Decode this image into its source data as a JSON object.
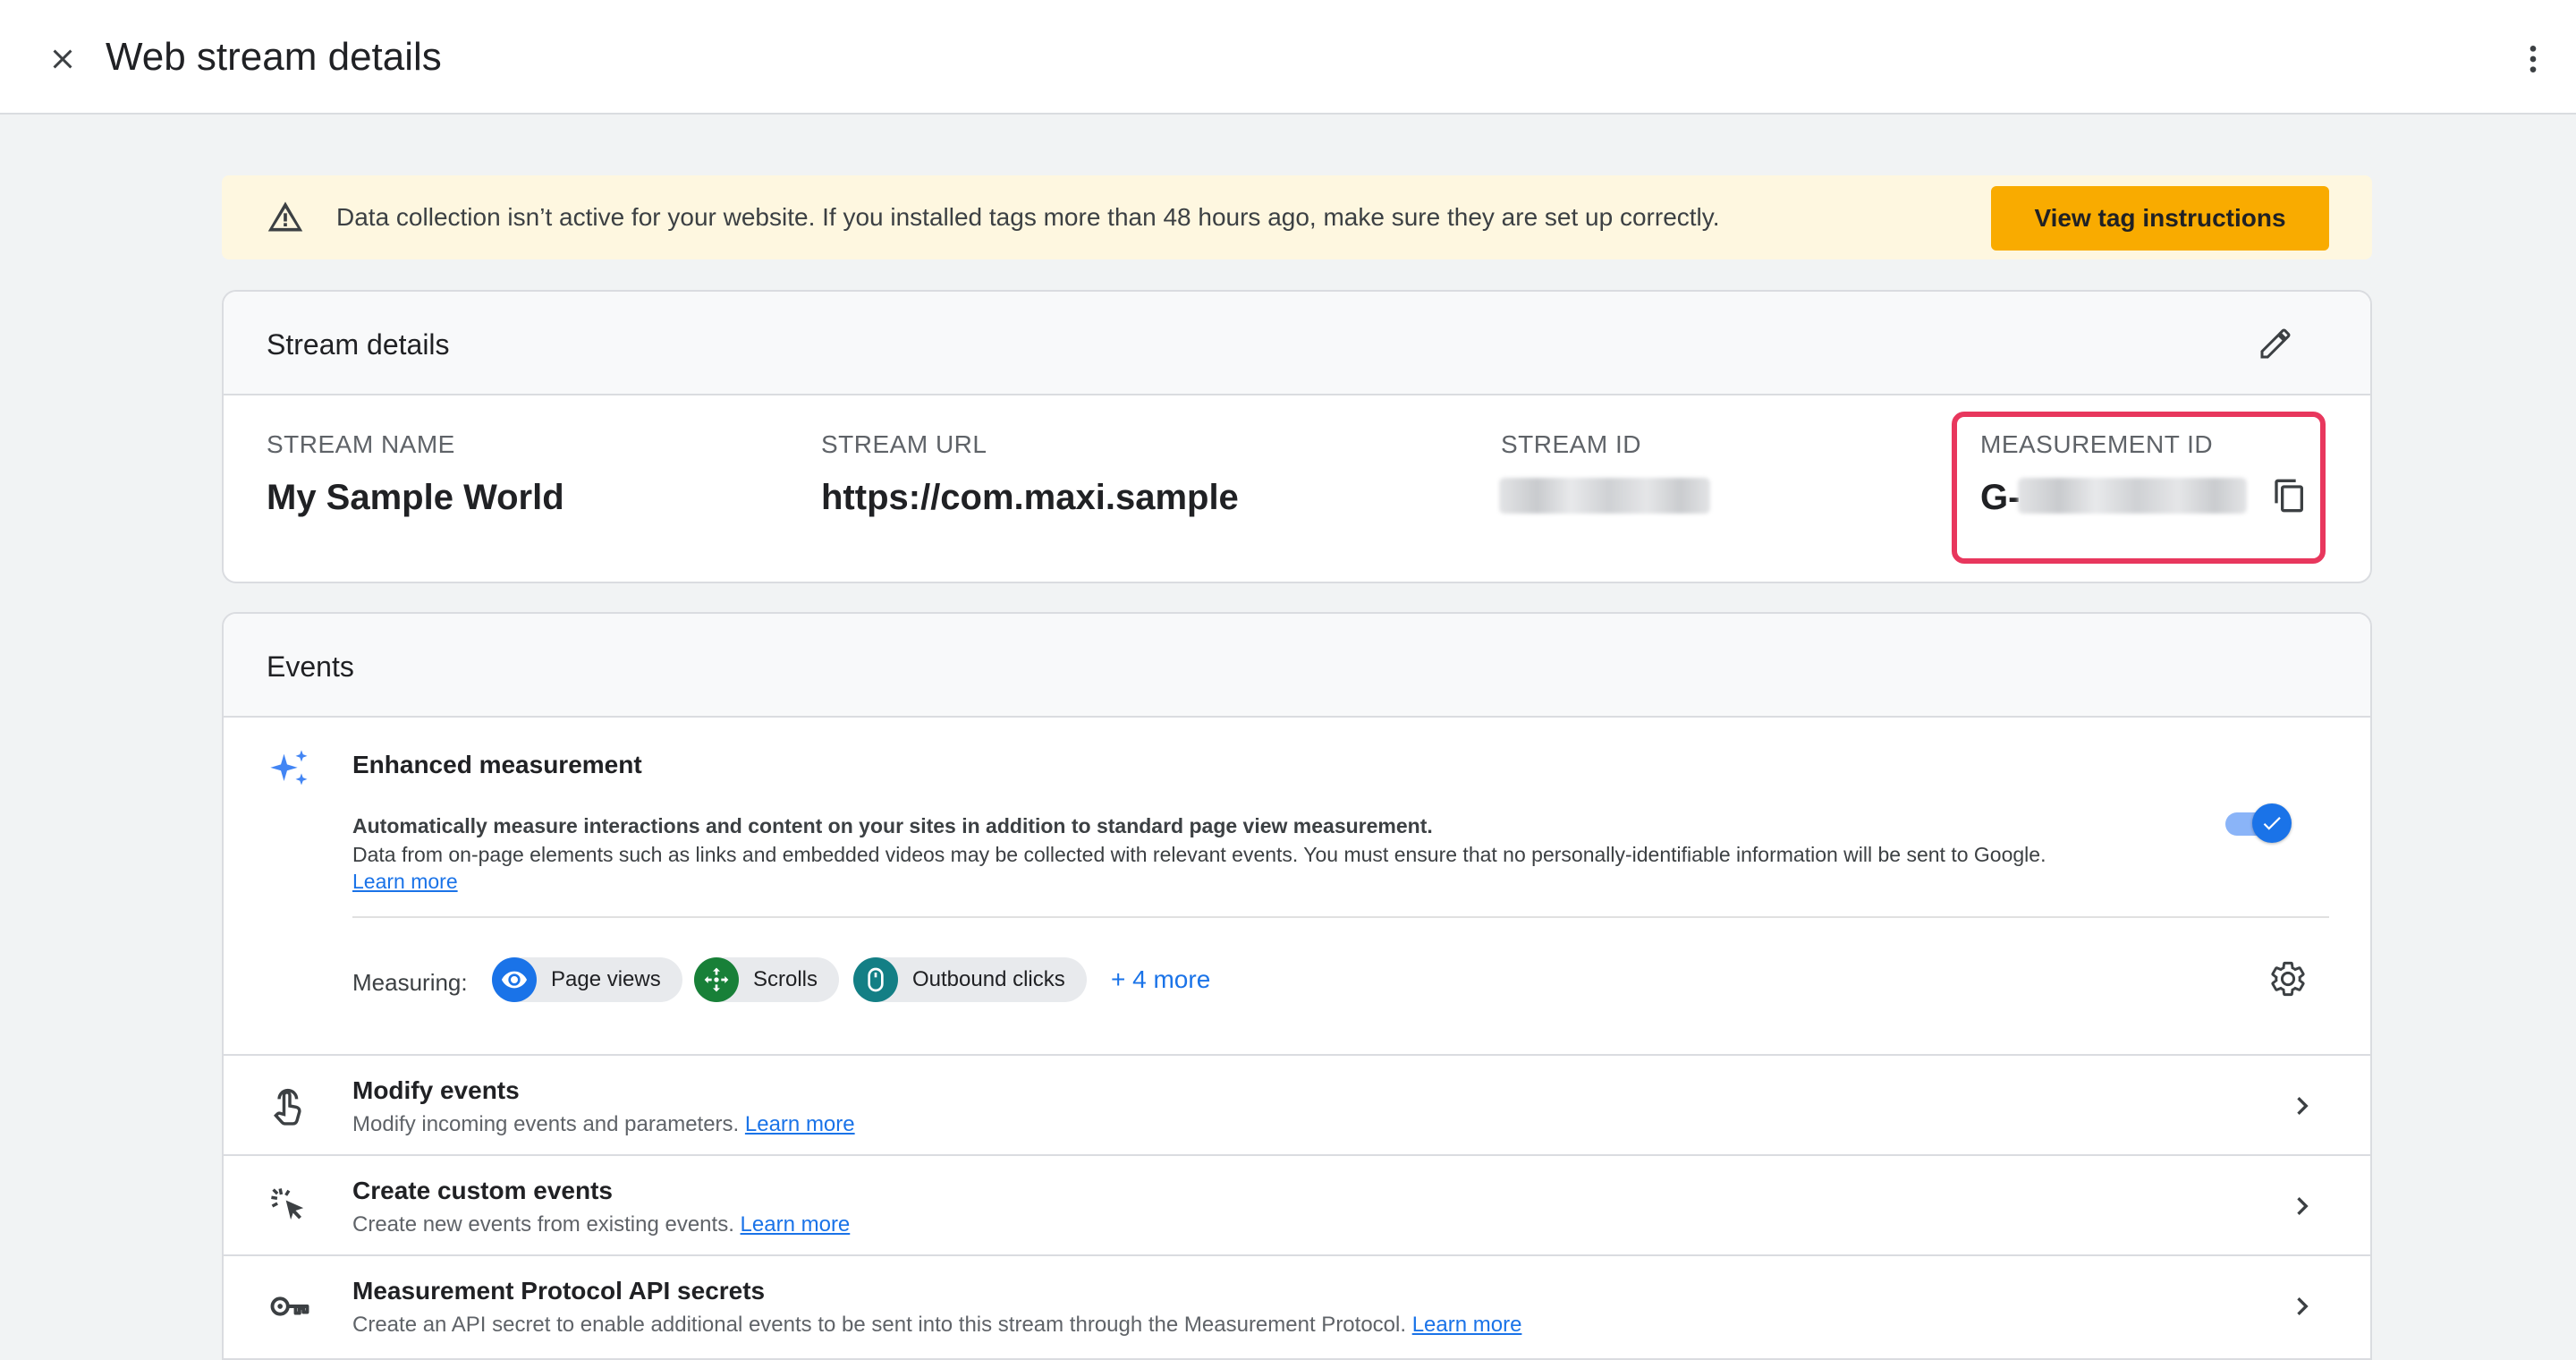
{
  "header": {
    "title": "Web stream details",
    "close_icon": "close-icon",
    "more_icon": "more-vert-icon"
  },
  "banner": {
    "message": "Data collection isn’t active for your website. If you installed tags more than 48 hours ago, make sure they are set up correctly.",
    "button_label": "View tag instructions",
    "icon": "warning-icon",
    "color_bg": "#fef7e0",
    "color_button": "#f9ab00"
  },
  "stream_details": {
    "title": "Stream details",
    "edit_icon": "edit-icon",
    "fields": [
      {
        "label": "STREAM NAME",
        "value": "My Sample World"
      },
      {
        "label": "STREAM URL",
        "value": "https://com.maxi.sample"
      },
      {
        "label": "STREAM ID",
        "value": ""
      },
      {
        "label": "MEASUREMENT ID",
        "value": "G-"
      }
    ],
    "copy_icon": "copy-icon",
    "highlight_color": "#e8375d"
  },
  "events": {
    "title": "Events",
    "enhanced": {
      "title": "Enhanced measurement",
      "desc_bold": "Automatically measure interactions and content on your sites in addition to standard page view measurement.",
      "desc": "Data from on-page elements such as links and embedded videos may be collected with relevant events. You must ensure that no personally-identifiable information will be sent to Google.",
      "link": "Learn more",
      "toggle_on": true,
      "icon": "sparkle-icon"
    },
    "measuring": {
      "label": "Measuring:",
      "chips": [
        {
          "label": "Page views",
          "icon": "eye-icon",
          "color": "#1a73e8"
        },
        {
          "label": "Scrolls",
          "icon": "scroll-target-icon",
          "color": "#188038"
        },
        {
          "label": "Outbound clicks",
          "icon": "mouse-icon",
          "color": "#137f85"
        }
      ],
      "more": "+ 4 more",
      "settings_icon": "gear-icon"
    },
    "rows": [
      {
        "title": "Modify events",
        "desc": "Modify incoming events and parameters.",
        "link": "Learn more",
        "icon": "touch-icon"
      },
      {
        "title": "Create custom events",
        "desc": "Create new events from existing events.",
        "link": "Learn more",
        "icon": "cursor-click-icon"
      },
      {
        "title": "Measurement Protocol API secrets",
        "desc": "Create an API secret to enable additional events to be sent into this stream through the Measurement Protocol.",
        "link": "Learn more",
        "icon": "key-icon"
      }
    ]
  }
}
